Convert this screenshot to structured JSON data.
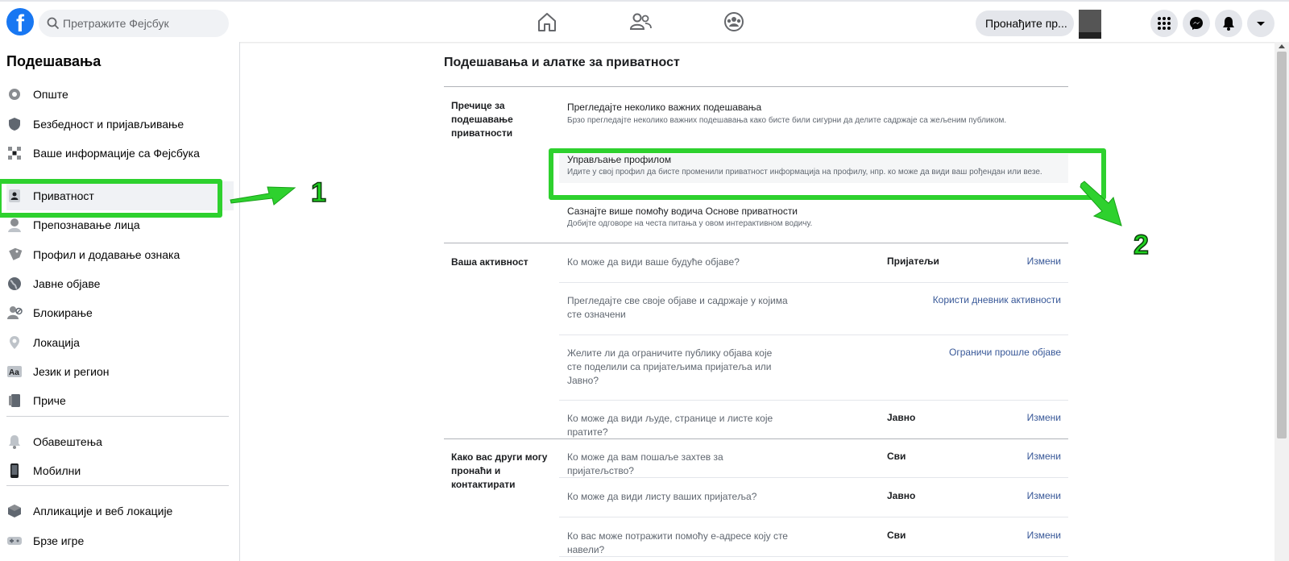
{
  "topbar": {
    "logo": "f",
    "search_placeholder": "Претражите Фејсбук",
    "find_friends_label": "Пронађите пр...",
    "nav_icons": [
      "home-icon",
      "friends-icon",
      "groups-icon"
    ],
    "right_icons": [
      "menu-grid-icon",
      "messenger-icon",
      "notifications-icon",
      "account-dropdown-icon"
    ]
  },
  "sidebar": {
    "title": "Подешавања",
    "items": [
      {
        "label": "Опште",
        "icon": "gear-icon"
      },
      {
        "label": "Безбедност и пријављивање",
        "icon": "shield-icon"
      },
      {
        "label": "Ваше информације са Фејсбука",
        "icon": "info-grid-icon"
      },
      {
        "label": "Приватност",
        "icon": "lock-person-icon"
      },
      {
        "label": "Препознавање лица",
        "icon": "face-icon"
      },
      {
        "label": "Профил и додавање ознака",
        "icon": "tag-icon"
      },
      {
        "label": "Јавне објаве",
        "icon": "globe-icon"
      },
      {
        "label": "Блокирање",
        "icon": "block-user-icon"
      },
      {
        "label": "Локација",
        "icon": "location-pin-icon"
      },
      {
        "label": "Језик и регион",
        "icon": "language-icon"
      },
      {
        "label": "Приче",
        "icon": "stories-icon"
      },
      {
        "label": "Обавештења",
        "icon": "bell-icon"
      },
      {
        "label": "Мобилни",
        "icon": "mobile-icon"
      },
      {
        "label": "Апликације и веб локације",
        "icon": "apps-cube-icon"
      },
      {
        "label": "Брзе игре",
        "icon": "gamepad-icon"
      }
    ]
  },
  "main": {
    "title": "Подешавања и алатке за приватност",
    "shortcuts": {
      "title": "Пречице за подешавање приватности",
      "links": [
        {
          "title": "Прегледајте неколико важних подешавања",
          "desc": "Брзо прегледајте неколико важних подешавања како бисте били сигурни да делите садржаје са жељеним публиком."
        },
        {
          "title": "Управљање профилом",
          "desc": "Идите у свој профил да бисте променили приватност информација на профилу, нпр. ко може да види ваш рођендан или везе."
        },
        {
          "title": "Сазнајте више помоћу водича Основе приватности",
          "desc": "Добијте одговоре на честа питања у овом интерактивном водичу."
        }
      ]
    },
    "activity": {
      "title": "Ваша активност",
      "rows": [
        {
          "q": "Ко може да види ваше будуће објаве?",
          "v": "Пријатељи",
          "a": "Измени"
        },
        {
          "q": "Прегледајте све своје објаве и садржаје у којима сте означени",
          "v": "",
          "a": "Користи дневник активности"
        },
        {
          "q": "Желите ли да ограничите публику објава које сте поделили са пријатељима пријатеља или Јавно?",
          "v": "",
          "a": "Ограничи прошле објаве"
        },
        {
          "q": "Ко може да види људе, странице и листе које пратите?",
          "v": "Јавно",
          "a": "Измени"
        }
      ]
    },
    "find": {
      "title": "Како вас други могу пронаћи и контактирати",
      "rows": [
        {
          "q": "Ко може да вам пошаље захтев за пријатељство?",
          "v": "Сви",
          "a": "Измени"
        },
        {
          "q": "Ко може да види листу ваших пријатеља?",
          "v": "Јавно",
          "a": "Измени"
        },
        {
          "q": "Ко вас може потражити помоћу е-адресе коју сте навели?",
          "v": "Сви",
          "a": "Измени"
        }
      ]
    }
  },
  "annotations": {
    "marker_1": "1",
    "marker_2": "2"
  },
  "colors": {
    "brand": "#1877f2",
    "link": "#385898",
    "annotation": "#2ed12e"
  }
}
